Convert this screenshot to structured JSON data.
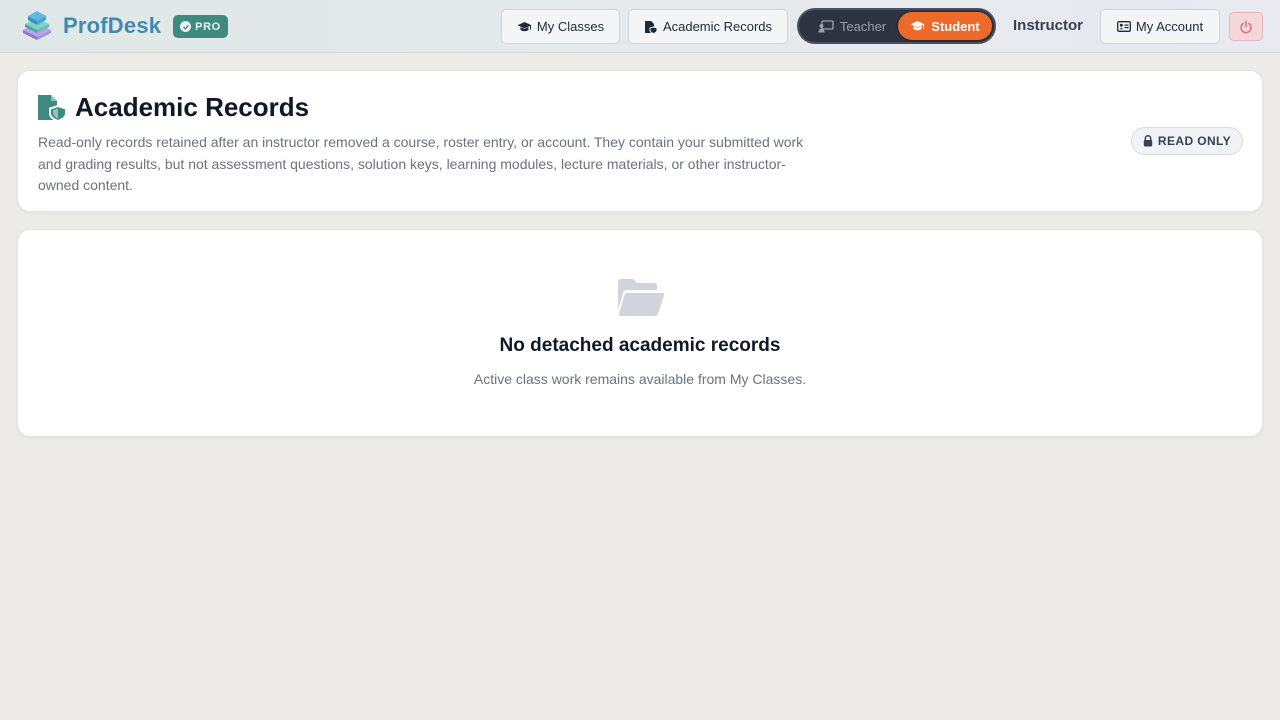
{
  "app": {
    "name": "ProfDesk",
    "badge": "PRO"
  },
  "nav": {
    "my_classes": "My Classes",
    "academic_records": "Academic Records",
    "my_account": "My Account"
  },
  "role_toggle": {
    "options": [
      "Teacher",
      "Student"
    ],
    "selected": "Student",
    "current_role_label": "Instructor"
  },
  "header": {
    "title": "Academic Records",
    "description": "Read-only records retained after an instructor removed a course, roster entry, or account. They contain your submitted work and grading results, but not assessment questions, solution keys, learning modules, lecture materials, or other instructor-owned content.",
    "status_badge": "READ ONLY"
  },
  "empty_state": {
    "title": "No detached academic records",
    "subtitle": "Active class work remains available from My Classes."
  },
  "colors": {
    "brand": "#3f8bb0",
    "pro_badge": "#3d8b7e",
    "student_active": "#ee6a2b",
    "toggle_bg": "#2d3340",
    "power_bg": "#f3d7da"
  },
  "icons": {
    "logo": "book-stack-icon",
    "pro": "check-circle-icon",
    "my_classes": "graduation-cap-icon",
    "academic_records": "file-shield-icon",
    "teacher": "chalkboard-teacher-icon",
    "student": "graduation-cap-icon",
    "account": "id-card-icon",
    "power": "power-icon",
    "read_only": "lock-icon",
    "empty": "open-folder-icon"
  }
}
